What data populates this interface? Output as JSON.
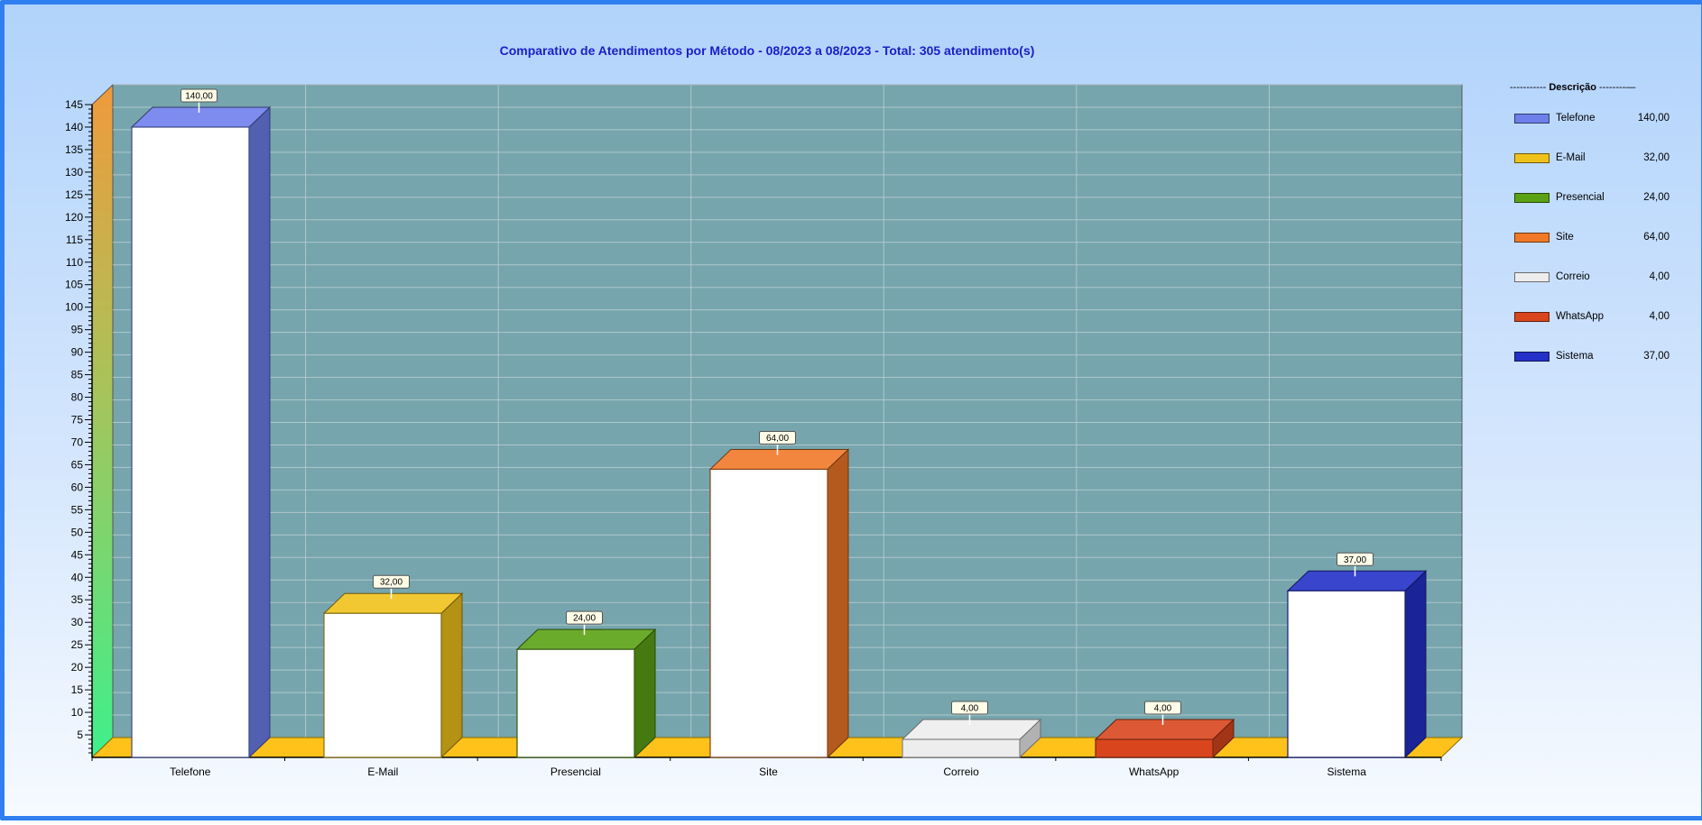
{
  "chart_data": {
    "type": "bar",
    "title": "Comparativo de Atendimentos por Método - 08/2023 a 08/2023 - Total: 305 atendimento(s)",
    "categories": [
      "Telefone",
      "E-Mail",
      "Presencial",
      "Site",
      "Correio",
      "WhatsApp",
      "Sistema"
    ],
    "values": [
      140,
      32,
      24,
      64,
      4,
      4,
      37
    ],
    "value_labels": [
      "140,00",
      "32,00",
      "24,00",
      "64,00",
      "4,00",
      "4,00",
      "37,00"
    ],
    "colors": [
      "#6e7fec",
      "#efc21b",
      "#5aa214",
      "#f07828",
      "#ededed",
      "#d9461e",
      "#2430c8"
    ],
    "ylim": [
      0,
      145
    ],
    "yticks": [
      5,
      10,
      15,
      20,
      25,
      30,
      35,
      40,
      45,
      50,
      55,
      60,
      65,
      70,
      75,
      80,
      85,
      90,
      95,
      100,
      105,
      110,
      115,
      120,
      125,
      130,
      135,
      140,
      145
    ],
    "grid": true,
    "legend_position": "right",
    "xlabel": "",
    "ylabel": ""
  },
  "legend": {
    "header_prefix": "----------- ",
    "header_title": "Descrição",
    "header_suffix": " --------—",
    "items": [
      {
        "label": "Telefone",
        "value": "140,00"
      },
      {
        "label": "E-Mail",
        "value": "32,00"
      },
      {
        "label": "Presencial",
        "value": "24,00"
      },
      {
        "label": "Site",
        "value": "64,00"
      },
      {
        "label": "Correio",
        "value": "4,00"
      },
      {
        "label": "WhatsApp",
        "value": "4,00"
      },
      {
        "label": "Sistema",
        "value": "37,00"
      }
    ]
  },
  "theme": {
    "plot_back": "#76a5ad",
    "floor": "#ffc21a",
    "title_color": "#1a20c8",
    "frame_border": "#2f7ff0"
  }
}
